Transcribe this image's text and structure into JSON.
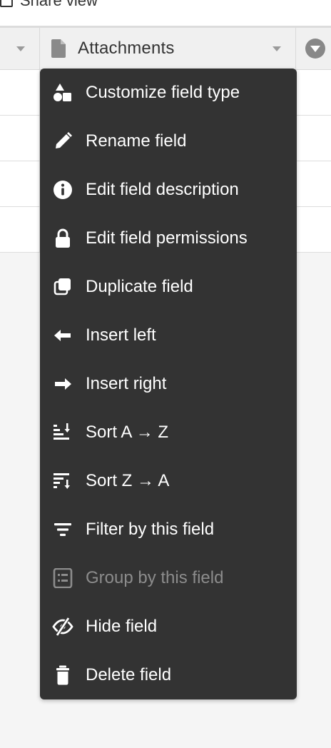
{
  "top": {
    "share_label": "Share view"
  },
  "header": {
    "column_title": "Attachments"
  },
  "menu": {
    "items": [
      {
        "label": "Customize field type",
        "icon": "shapes-icon",
        "enabled": true
      },
      {
        "label": "Rename field",
        "icon": "pencil-icon",
        "enabled": true
      },
      {
        "label": "Edit field description",
        "icon": "info-icon",
        "enabled": true
      },
      {
        "label": "Edit field permissions",
        "icon": "lock-icon",
        "enabled": true
      },
      {
        "label": "Duplicate field",
        "icon": "duplicate-icon",
        "enabled": true
      },
      {
        "label": "Insert left",
        "icon": "arrow-left-icon",
        "enabled": true
      },
      {
        "label": "Insert right",
        "icon": "arrow-right-icon",
        "enabled": true
      },
      {
        "label": "Sort A → Z",
        "icon": "sort-ascending-icon",
        "enabled": true
      },
      {
        "label": "Sort Z → A",
        "icon": "sort-descending-icon",
        "enabled": true
      },
      {
        "label": "Filter by this field",
        "icon": "filter-icon",
        "enabled": true
      },
      {
        "label": "Group by this field",
        "icon": "group-icon",
        "enabled": false
      },
      {
        "label": "Hide field",
        "icon": "eye-slash-icon",
        "enabled": true
      },
      {
        "label": "Delete field",
        "icon": "trash-icon",
        "enabled": true
      }
    ]
  },
  "colors": {
    "menu_bg": "#333333",
    "menu_text": "#ffffff",
    "disabled_text": "#8c8c8c",
    "header_bg": "#f0f0f0"
  }
}
